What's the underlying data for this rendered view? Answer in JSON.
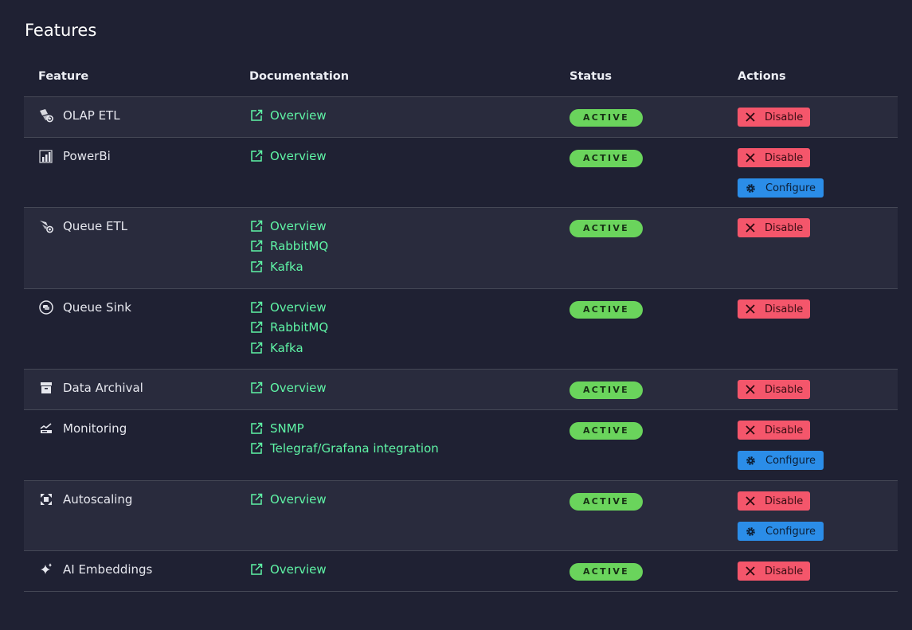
{
  "page": {
    "title": "Features"
  },
  "table": {
    "headers": {
      "feature": "Feature",
      "documentation": "Documentation",
      "status": "Status",
      "actions": "Actions"
    },
    "rows": [
      {
        "name": "OLAP ETL",
        "icon": "olap-etl-icon",
        "docs": [
          "Overview"
        ],
        "status": "ACTIVE",
        "actions": [
          "Disable"
        ]
      },
      {
        "name": "PowerBi",
        "icon": "powerbi-icon",
        "docs": [
          "Overview"
        ],
        "status": "ACTIVE",
        "actions": [
          "Disable",
          "Configure"
        ]
      },
      {
        "name": "Queue ETL",
        "icon": "queue-etl-icon",
        "docs": [
          "Overview",
          "RabbitMQ",
          "Kafka"
        ],
        "status": "ACTIVE",
        "actions": [
          "Disable"
        ]
      },
      {
        "name": "Queue Sink",
        "icon": "queue-sink-icon",
        "docs": [
          "Overview",
          "RabbitMQ",
          "Kafka"
        ],
        "status": "ACTIVE",
        "actions": [
          "Disable"
        ]
      },
      {
        "name": "Data Archival",
        "icon": "archive-icon",
        "docs": [
          "Overview"
        ],
        "status": "ACTIVE",
        "actions": [
          "Disable"
        ]
      },
      {
        "name": "Monitoring",
        "icon": "monitoring-icon",
        "docs": [
          "SNMP",
          "Telegraf/Grafana integration"
        ],
        "status": "ACTIVE",
        "actions": [
          "Disable",
          "Configure"
        ]
      },
      {
        "name": "Autoscaling",
        "icon": "autoscaling-icon",
        "docs": [
          "Overview"
        ],
        "status": "ACTIVE",
        "actions": [
          "Disable",
          "Configure"
        ]
      },
      {
        "name": "AI Embeddings",
        "icon": "ai-sparkle-icon",
        "docs": [
          "Overview"
        ],
        "status": "ACTIVE",
        "actions": [
          "Disable"
        ]
      }
    ]
  },
  "colors": {
    "background": "#1f2133",
    "row_alt": "#292b3d",
    "link": "#5ff5a6",
    "status_active": "#6ad45c",
    "disable_button": "#f4566b",
    "configure_button": "#2b8de8"
  }
}
